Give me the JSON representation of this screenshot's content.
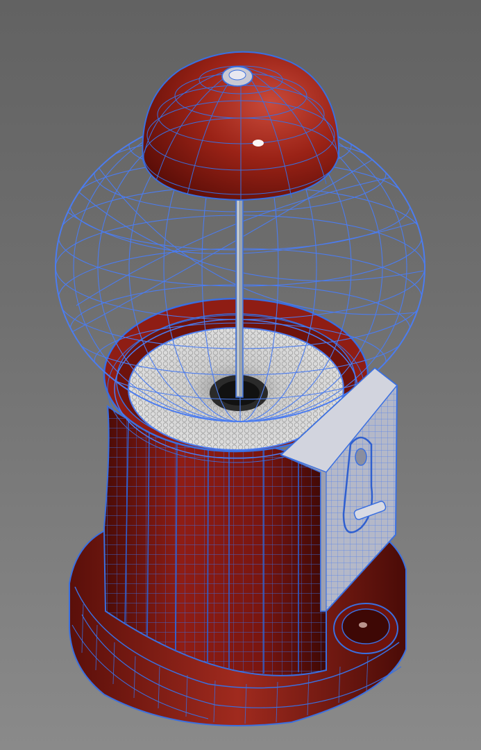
{
  "viewport": {
    "background_top": "#626262",
    "background_bottom": "#8a8a8a",
    "shading_mode": "smooth-shaded-with-wireframe-overlay"
  },
  "model": {
    "subject": "gumball-machine",
    "colors": {
      "body_red": "#8f1d14",
      "body_red_dark": "#5a0f0a",
      "body_red_light": "#b8392c",
      "wireframe_blue": "#3a6fe0",
      "glass_wire": "#4b7cf0",
      "gumball_fill": "#cfcfcf",
      "coin_plate": "#c8c8d2",
      "rod_metal": "#9aa3ad"
    },
    "parts": [
      "dome-cap",
      "glass-globe",
      "center-rod",
      "gumball-fill",
      "body-cylinder",
      "coin-mechanism",
      "base-plinth",
      "gumball-chute"
    ]
  }
}
